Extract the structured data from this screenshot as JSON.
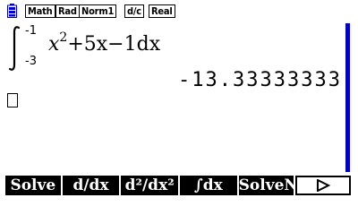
{
  "status_bar": {
    "battery_icon": "battery-icon",
    "modes": [
      "Math",
      "Rad",
      "Norm1",
      "d/c",
      "Real"
    ]
  },
  "calculation": {
    "upper_limit": "-1",
    "lower_limit": "-3",
    "integrand": [
      "x",
      "2",
      "+5x−1dx"
    ],
    "result": "-13.33333333"
  },
  "softkeys": {
    "labels": [
      "Solve",
      "d/dx",
      "d²/dx²",
      "∫dx",
      "SolveN"
    ],
    "more_icon": "right-triangle-icon"
  },
  "colors": {
    "scrollbar": "#0000c8",
    "battery": "#0000c8"
  }
}
